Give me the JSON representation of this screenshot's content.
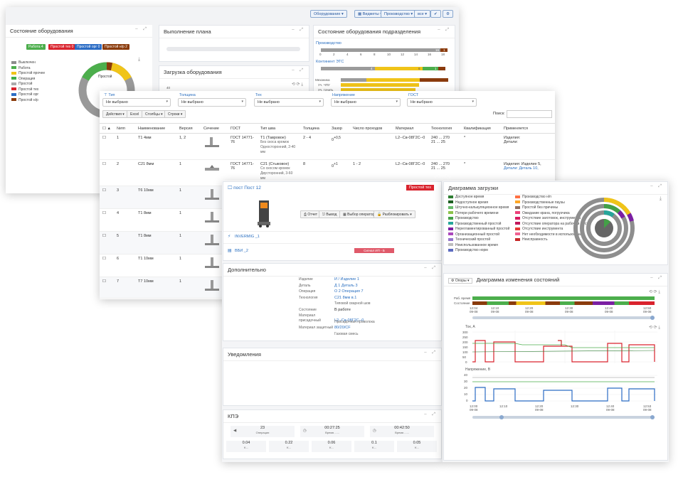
{
  "toolbar": {
    "equipment_btn": "Оборудование",
    "widgets_btn": "Виджеты",
    "production_btn": "Производство",
    "all_btn": "все"
  },
  "equipment_state": {
    "title": "Состояние оборудования",
    "badges": [
      {
        "label": "Работа 4",
        "color": "#4cae4c"
      },
      {
        "label": "Простой тех 0",
        "color": "#d9232d"
      },
      {
        "label": "Простой орг 0",
        "color": "#2b6cc4"
      },
      {
        "label": "Простой н/р 2",
        "color": "#8a3b0c"
      }
    ],
    "legend": [
      {
        "label": "Выключен",
        "color": "#8c8c8c"
      },
      {
        "label": "Работа",
        "color": "#4cae4c"
      },
      {
        "label": "Простой прочее",
        "color": "#f0c419"
      },
      {
        "label": "Операция",
        "color": "#3fae49"
      },
      {
        "label": "Простой",
        "color": "#aaaaaa"
      },
      {
        "label": "Простой тех",
        "color": "#d9232d"
      },
      {
        "label": "Простой орг",
        "color": "#2b6cc4"
      },
      {
        "label": "Простой н/р",
        "color": "#8a3b0c"
      }
    ],
    "donut_label": "Простой"
  },
  "plan": {
    "title": "Выполнение плана"
  },
  "load": {
    "title": "Загрузка оборудования",
    "ticks": [
      "40",
      "30"
    ]
  },
  "subdiv": {
    "title": "Состояние оборудования подразделения",
    "group1": "Производство",
    "group2": "Континент ЭТС",
    "g1_value": "16",
    "g1_value_end": "1",
    "g2_values": [
      "4",
      "6",
      "1"
    ],
    "x_ticks": [
      "0",
      "2",
      "4",
      "6",
      "8",
      "10",
      "12",
      "14",
      "16",
      "18"
    ],
    "rows": [
      {
        "label": "Механика"
      },
      {
        "label": "Уч. ЧПУ"
      },
      {
        "label": "Уч. точить"
      }
    ]
  },
  "filters": {
    "labels": [
      "Тип",
      "Толщина",
      "Тех",
      "Напряжение",
      "ГОСТ"
    ],
    "value": "Не выбрано",
    "actions": [
      "Действия",
      "Excel",
      "Столбцы",
      "Строки"
    ],
    "search_label": "Поиск:"
  },
  "table": {
    "headers": [
      "№пп",
      "Наименование",
      "Версия",
      "Сечение",
      "ГОСТ",
      "Тип шва",
      "Толщина",
      "Зазор",
      "Число проходов",
      "Материал",
      "Технология",
      "Квалификация",
      "Применяется"
    ],
    "rows": [
      {
        "n": "1",
        "name": "Т1 4мм",
        "ver": "1, 2",
        "gost": "ГОСТ 14771-76",
        "type": "Т1 (Тавровое)",
        "type2": "Без скоса кромок",
        "type3": "Односторонний, 2-40 мм",
        "thick": "2 - 4",
        "gap": "0",
        "gap_sup": "+0,5",
        "passes": "",
        "mat": "L2--Св-08Г2С--0",
        "tech1": "240 ... 270",
        "tech2": "21 ... 25",
        "qual": "*",
        "use1": "Изделия:",
        "use2": "Детали:"
      },
      {
        "n": "2",
        "name": "С21 8мм",
        "ver": "1",
        "gost": "ГОСТ 14771-76",
        "type": "С21 (Стыковое)",
        "type2": "Со скосом кромок",
        "type3": "Двусторонний, 3-60 мм",
        "thick": "8",
        "gap": "0",
        "gap_sup": "+1",
        "passes": "1 - 2",
        "mat": "L2--Св-08Г2С--0",
        "tech1": "240 ... 270",
        "tech2": "21 ... 25",
        "qual": "*",
        "use1": "Изделия: Изделие 5,",
        "use2": "Детали: Деталь 10,"
      },
      {
        "n": "3",
        "name": "Т6 10мм",
        "ver": "1"
      },
      {
        "n": "4",
        "name": "Т1 8мм",
        "ver": "1"
      },
      {
        "n": "5",
        "name": "Т1 8мм",
        "ver": "1"
      },
      {
        "n": "6",
        "name": "Т1 10мм",
        "ver": "1"
      },
      {
        "n": "7",
        "name": "Т7 10мм",
        "ver": "1"
      }
    ]
  },
  "post": {
    "title": "пост Пост 12",
    "status": "Простой тех",
    "buttons": [
      "Отчет",
      "Вывод",
      "Выбор оператора",
      "Разблокировать"
    ],
    "device1": "INVERMIG _1",
    "device2": "ВБИ _2",
    "signal": "Сигнал ИП - Б"
  },
  "extra": {
    "title": "Дополнительно",
    "rows": [
      {
        "k": "Изделие",
        "v": "И / Изделие 1",
        "link": true
      },
      {
        "k": "Деталь",
        "v": "Д 1 Деталь 3",
        "link": true
      },
      {
        "k": "Операция",
        "v": "О 2 Операция 7",
        "link": true
      },
      {
        "k": "Технология",
        "v": "С21 8мм в.1",
        "link": true
      },
      {
        "k": "",
        "v": "Типовой сварной шов",
        "link": false
      },
      {
        "k": "Состояние",
        "v": "В работе",
        "link": false
      },
      {
        "k": "Материал присадочный",
        "v": "L2--Св-08Г2С--0",
        "link": true
      },
      {
        "k": "",
        "v": "Присадочная проволока",
        "link": false
      },
      {
        "k": "Материал защитный",
        "v": "80/20/CF",
        "link": true
      },
      {
        "k": "",
        "v": "Газовая смесь",
        "link": false
      }
    ]
  },
  "notify": {
    "title": "Уведомления"
  },
  "kpe": {
    "title": "КПЭ",
    "top": [
      {
        "v": "23",
        "l": "Операции"
      },
      {
        "v": "00:27:25",
        "l": "Время ......"
      },
      {
        "v": "00:42:50",
        "l": "Время ......"
      }
    ],
    "bottom": [
      {
        "v": "0.04",
        "l": "K..."
      },
      {
        "v": "0.22",
        "l": "K..."
      },
      {
        "v": "0.06",
        "l": "K..."
      },
      {
        "v": "0.1",
        "l": "K..."
      },
      {
        "v": "0.05",
        "l": "K..."
      }
    ]
  },
  "loadchart": {
    "title": "Диаграмма загрузки",
    "legend_left": [
      {
        "label": "Доступное время",
        "color": "#2e7d32"
      },
      {
        "label": "Недоступное время",
        "color": "#1b5e20"
      },
      {
        "label": "Штучно-калькуляционное время",
        "color": "#66bb6a"
      },
      {
        "label": "Потери рабочего времени",
        "color": "#8bc34a"
      },
      {
        "label": "Производство",
        "color": "#43a047"
      },
      {
        "label": "Производственный простой",
        "color": "#26a69a"
      },
      {
        "label": "Нерегламентированный простой",
        "color": "#7b1fa2"
      },
      {
        "label": "Организационный простой",
        "color": "#ab47bc"
      },
      {
        "label": "Технический простой",
        "color": "#9575cd"
      },
      {
        "label": "Неиспользованное время",
        "color": "#bdbdbd"
      },
      {
        "label": "Производство норм",
        "color": "#5c6bc0"
      }
    ],
    "legend_right": [
      {
        "label": "Производство н/п",
        "color": "#ff7043"
      },
      {
        "label": "Производственные паузы",
        "color": "#ffa726"
      },
      {
        "label": "Простой без причины",
        "color": "#8d6e63"
      },
      {
        "label": "Ожидание крана, погрузчика",
        "color": "#ec407a"
      },
      {
        "label": "Отсутствие заготовок, инструмента",
        "color": "#d81b60"
      },
      {
        "label": "Отсутствие оператора на рабочем месте",
        "color": "#c2185b"
      },
      {
        "label": "Отсутствие инструмента",
        "color": "#e53935"
      },
      {
        "label": "Нет необходимости в использовании",
        "color": "#f06292"
      },
      {
        "label": "Неисправность",
        "color": "#c62828"
      }
    ]
  },
  "statechart": {
    "title": "Диаграмма изменения состояний",
    "select": "Опоры",
    "rows": [
      "Раб. время",
      "Состояние"
    ],
    "time_ticks": [
      "12:04",
      "12:10",
      "12:20",
      "12:30",
      "12:40",
      "12:50"
    ],
    "date_tick": "09-08",
    "current_label": "Ток, А",
    "voltage_label": "Напряжение, В",
    "current_ticks": [
      "300",
      "250",
      "200",
      "150",
      "100",
      "50",
      "0"
    ],
    "voltage_ticks": [
      "40",
      "30",
      "20",
      "10",
      "0"
    ],
    "bottom_ticks": [
      "12:00",
      "12:10",
      "12:20",
      "12:30",
      "12:40",
      "12:53"
    ]
  }
}
